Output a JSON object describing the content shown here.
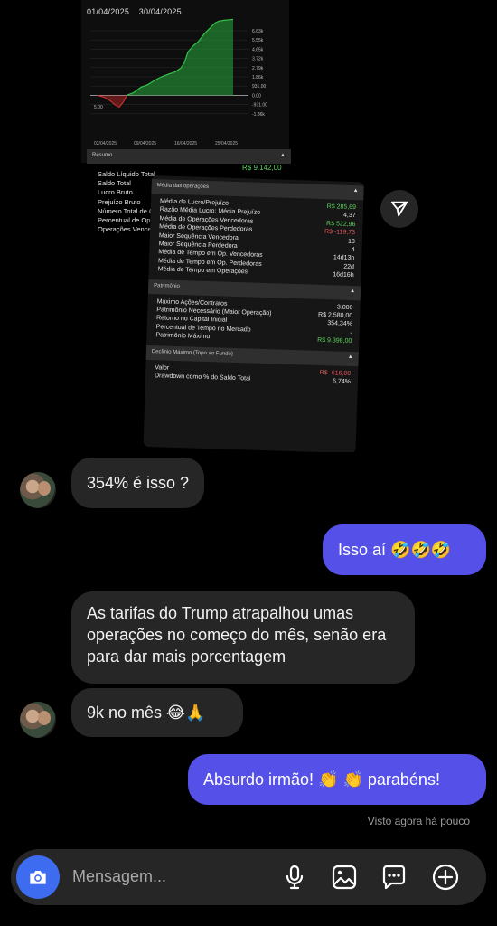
{
  "shared_image": {
    "chart": {
      "date_start": "01/04/2025",
      "date_end": "30/04/2025",
      "y_ticks": [
        "6.63k",
        "5.55k",
        "4.65k",
        "3.72k",
        "2.79k",
        "1.86k",
        "931.00",
        "0.00",
        "-931.00",
        "-1.86k"
      ],
      "x_ticks": [
        "02/04/2025",
        "09/04/2025",
        "16/04/2025",
        "25/04/2025"
      ],
      "start_label": "5.00",
      "line_color": "#34c24a"
    },
    "resumo": {
      "title": "Resumo",
      "items": [
        "Saldo Líquido Total",
        "Saldo Total",
        "Lucro Bruto",
        "Prejuízo Bruto",
        "Número Total de O",
        "Percentual de Op",
        "Operações Vence"
      ],
      "value": "R$ 9.142,00"
    },
    "media": {
      "title": "Média das operações",
      "rows": [
        {
          "label": "Média de Lucro/Prejuízo",
          "value": "R$ 285,69",
          "tone": "green"
        },
        {
          "label": "Razão Média Lucro: Média Prejuízo",
          "value": "4,37",
          "tone": ""
        },
        {
          "label": "Média de Operações Vencedoras",
          "value": "R$ 522,96",
          "tone": "green"
        },
        {
          "label": "Média de Operações Perdedoras",
          "value": "R$ -119,73",
          "tone": "red"
        },
        {
          "label": "Maior Sequência Vencedora",
          "value": "13",
          "tone": ""
        },
        {
          "label": "Maior Sequência Perdedora",
          "value": "4",
          "tone": ""
        },
        {
          "label": "Média de Tempo em Op. Vencedoras",
          "value": "14d13h",
          "tone": ""
        },
        {
          "label": "Média de Tempo em Op. Perdedoras",
          "value": "22d",
          "tone": ""
        },
        {
          "label": "Média de Tempo em Operações",
          "value": "16d16h",
          "tone": ""
        }
      ]
    },
    "patrimonio": {
      "title": "Patrimônio",
      "rows": [
        {
          "label": "Máximo Ações/Contratos",
          "value": "3.000",
          "tone": ""
        },
        {
          "label": "Patrimônio Necessário (Maior Operação)",
          "value": "R$ 2.580,00",
          "tone": ""
        },
        {
          "label": "Retorno no Capital Inicial",
          "value": "354,34%",
          "tone": ""
        },
        {
          "label": "Percentual de Tempo no Mercado",
          "value": "-",
          "tone": ""
        },
        {
          "label": "Patrimônio Máximo",
          "value": "R$ 9.398,00",
          "tone": "green"
        }
      ]
    },
    "declinio": {
      "title": "Declínio Máximo (Topo ao Fundo)",
      "rows": [
        {
          "label": "Valor",
          "value": "R$ -616,00",
          "tone": "red"
        },
        {
          "label": "Drawdown como % do Saldo Total",
          "value": "6,74%",
          "tone": ""
        }
      ]
    }
  },
  "messages": [
    {
      "from": "them",
      "text": "354% é isso ?"
    },
    {
      "from": "me",
      "text": "Isso aí 🤣🤣🤣"
    },
    {
      "from": "them",
      "text": "As tarifas do Trump atrapalhou umas operações no começo do mês, senão era para dar mais porcentagem"
    },
    {
      "from": "them",
      "text": "9k no mês 😂🙏"
    },
    {
      "from": "me",
      "text": "Absurdo irmão! 👏 👏 parabéns!"
    }
  ],
  "seen_status": "Visto agora há pouco",
  "composer": {
    "placeholder": "Mensagem...",
    "icons": [
      "camera-icon",
      "microphone-icon",
      "gallery-icon",
      "sticker-icon",
      "plus-icon"
    ]
  },
  "colors": {
    "outgoing_bubble": "#5551e8",
    "incoming_bubble": "#262626",
    "camera_button": "#3d6cf1",
    "positive": "#5fd35f",
    "negative": "#e05555"
  }
}
